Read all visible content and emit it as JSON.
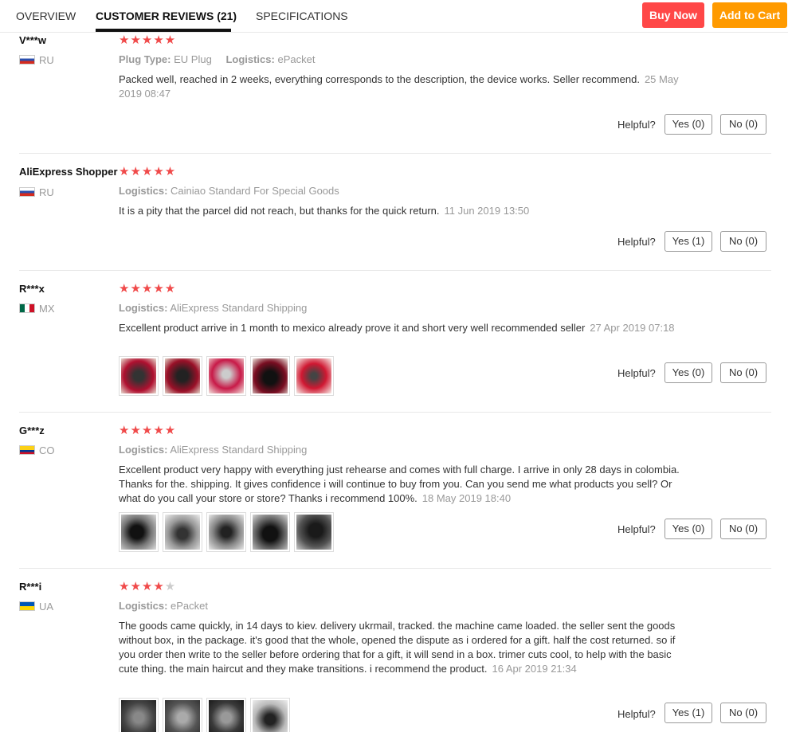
{
  "tabs": {
    "overview": "OVERVIEW",
    "reviews": "CUSTOMER REVIEWS (21)",
    "specifications": "SPECIFICATIONS"
  },
  "actions": {
    "buy_now": "Buy Now",
    "add_to_cart": "Add to Cart",
    "buy_color": "#ff4747",
    "cart_color": "#ff9a00"
  },
  "helpful_label": "Helpful?",
  "reviews": [
    {
      "user": "V***w",
      "country": "RU",
      "flag": "russia",
      "stars": 5,
      "attrs": [
        {
          "label": "Plug Type:",
          "value": "EU Plug"
        },
        {
          "label": "Logistics:",
          "value": "ePacket"
        }
      ],
      "text": "Packed well, reached in 2 weeks, everything corresponds to the description, the device works. Seller recommend.",
      "date": "25 May 2019 08:47",
      "yes": "Yes (0)",
      "no": "No (0)"
    },
    {
      "user": "AliExpress Shopper",
      "country": "RU",
      "flag": "russia",
      "stars": 5,
      "attrs": [
        {
          "label": "Logistics:",
          "value": "Cainiao Standard For Special Goods"
        }
      ],
      "text": "It is a pity that the parcel did not reach, but thanks for the quick return.",
      "date": "11 Jun 2019 13:50",
      "yes": "Yes (1)",
      "no": "No (0)"
    },
    {
      "user": "R***x",
      "country": "MX",
      "flag": "mexico",
      "stars": 5,
      "attrs": [
        {
          "label": "Logistics:",
          "value": "AliExpress Standard Shipping"
        }
      ],
      "text": "Excellent product arrive in 1 month to mexico already prove it and short very well recommended seller",
      "date": "27 Apr 2019 07:18",
      "yes": "Yes (0)",
      "no": "No (0)"
    },
    {
      "user": "G***z",
      "country": "CO",
      "flag": "colombia",
      "stars": 5,
      "attrs": [
        {
          "label": "Logistics:",
          "value": "AliExpress Standard Shipping"
        }
      ],
      "text": "Excellent product very happy with everything just rehearse and comes with full charge. I arrive in only 28 days in colombia. Thanks for the. shipping. It gives confidence i will continue to buy from you. Can you send me what products you sell? Or what do you call your store or store? Thanks i recommend 100%.",
      "date": "18 May 2019 18:40",
      "yes": "Yes (0)",
      "no": "No (0)"
    },
    {
      "user": "R***i",
      "country": "UA",
      "flag": "ukraine",
      "stars": 4,
      "attrs": [
        {
          "label": "Logistics:",
          "value": "ePacket"
        }
      ],
      "text": "The goods came quickly, in 14 days to kiev. delivery ukrmail, tracked. the machine came loaded. the seller sent the goods without box, in the package. it's good that the whole, opened the dispute as i ordered for a gift. half the cost returned. so if you order then write to the seller before ordering that for a gift, it will send in a box. trimer cuts cool, to help with the basic cute thing. the main haircut and they make transitions. i recommend the product.",
      "date": "16 Apr 2019 21:34",
      "yes": "Yes (1)",
      "no": "No (0)"
    }
  ]
}
